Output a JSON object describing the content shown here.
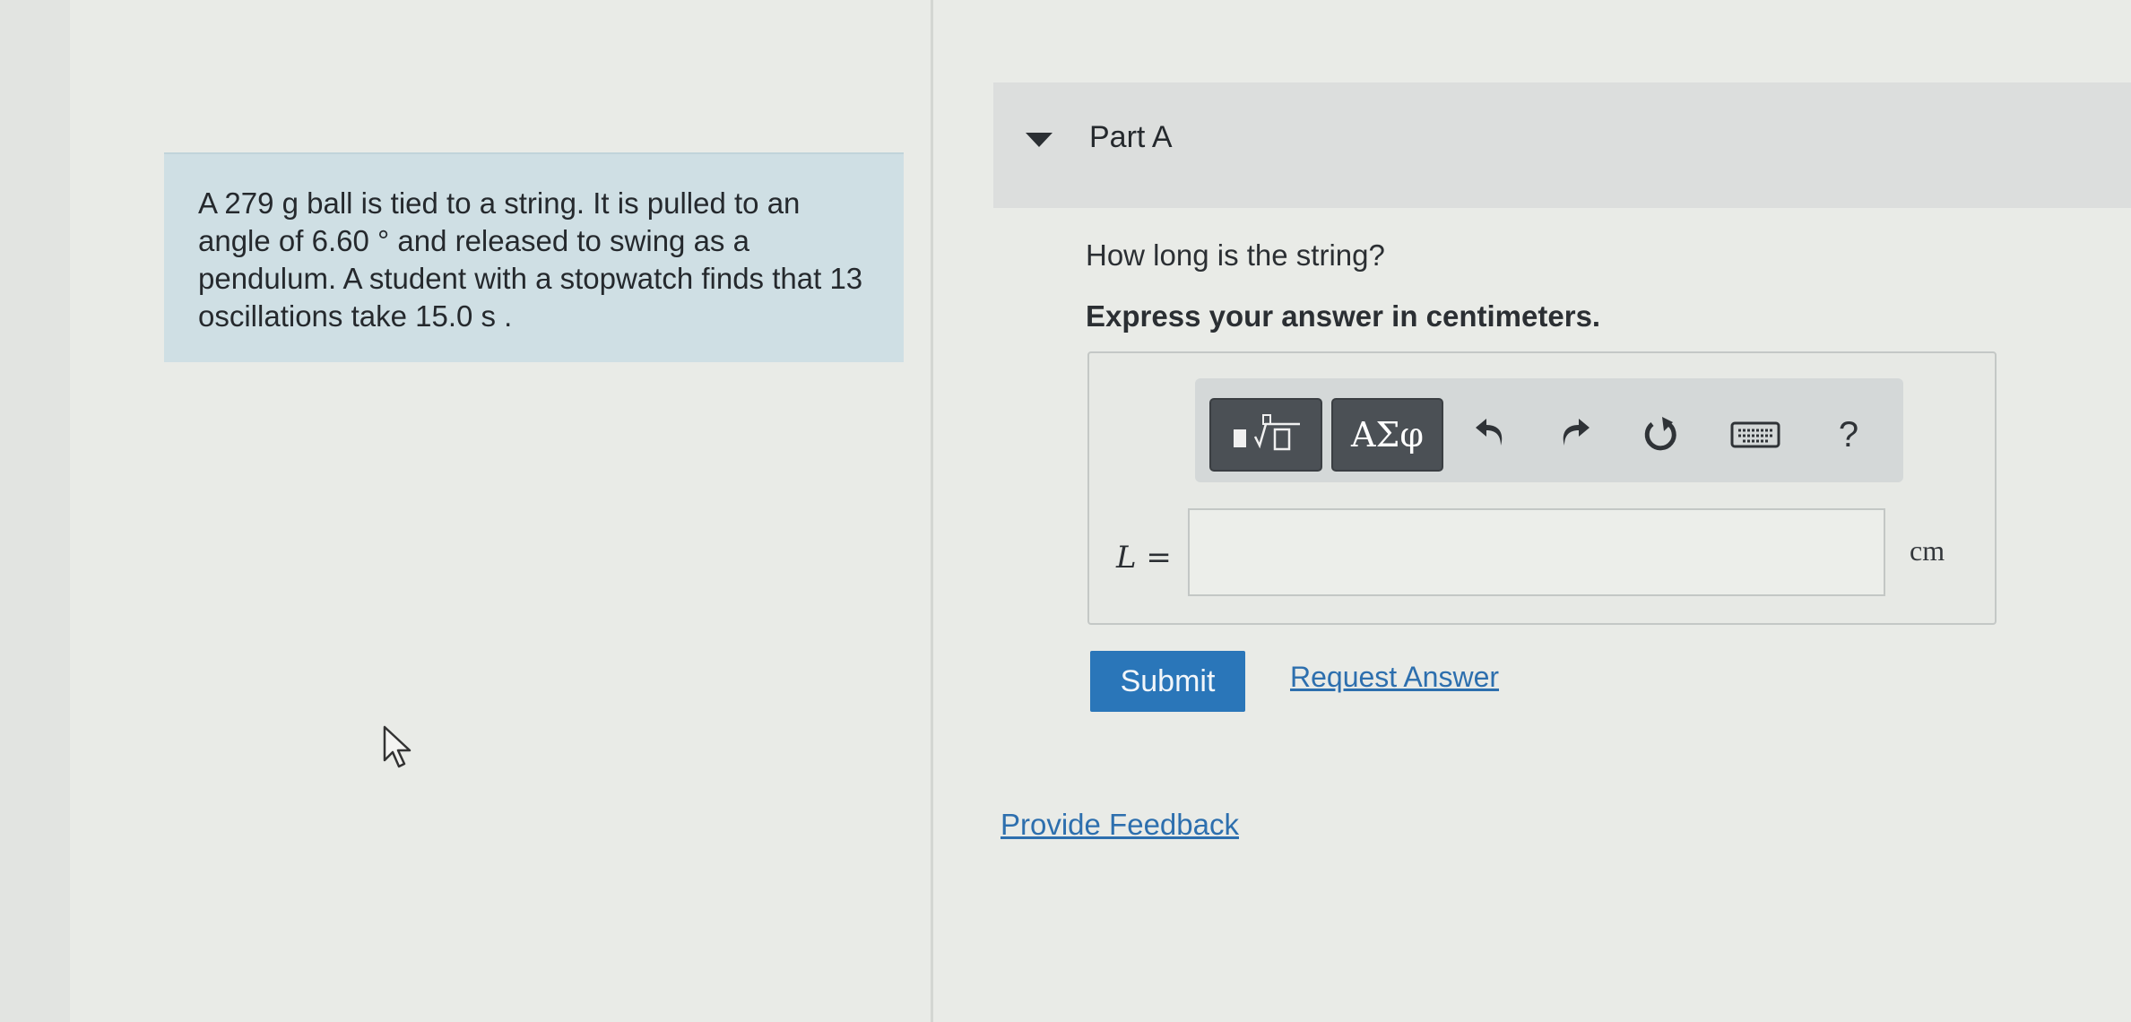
{
  "problem": {
    "lines": [
      "A 279  g ball is tied to a string. It is pulled to an",
      "angle of 6.60 °  and released to swing as a",
      "pendulum. A student with a stopwatch finds that 13",
      "oscillations take 15.0  s ."
    ]
  },
  "part": {
    "title": "Part A",
    "expanded": true
  },
  "question": "How long is the string?",
  "instruction": "Express your answer in centimeters.",
  "toolbar": {
    "greek_label": "ΑΣφ",
    "help_label": "?",
    "icons": [
      "templates-icon",
      "undo-icon",
      "redo-icon",
      "reset-icon",
      "keyboard-icon",
      "help-icon"
    ]
  },
  "answer": {
    "variable": "L =",
    "value": "",
    "unit": "cm"
  },
  "actions": {
    "submit": "Submit",
    "request_answer": "Request Answer",
    "provide_feedback": "Provide Feedback"
  },
  "colors": {
    "accent": "#2a76b9",
    "link": "#2d6fae",
    "problem_bg": "#cfdfe4",
    "toolbar_button": "#4b5055"
  }
}
